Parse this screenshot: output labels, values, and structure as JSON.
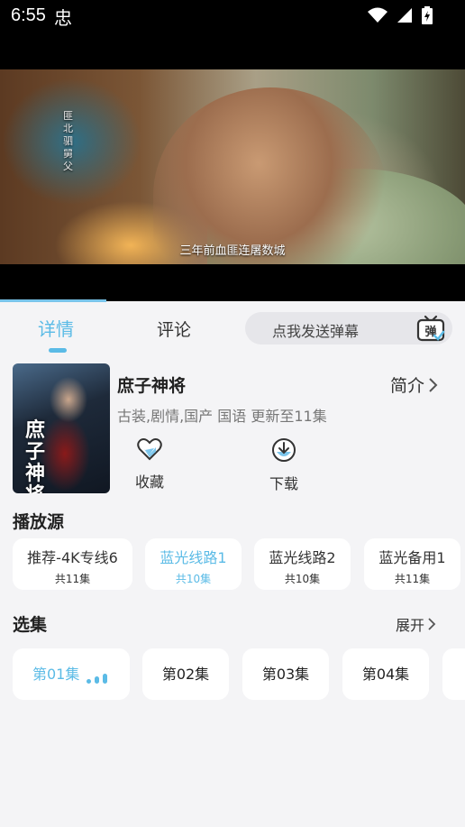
{
  "status_bar": {
    "time": "6:55",
    "notif_char": "忠"
  },
  "video": {
    "subtitle": "三年前血匪连屠数城",
    "vertical_text": "匪北驷舅父"
  },
  "tabs": {
    "detail": "详情",
    "comment": "评论"
  },
  "danmu": {
    "placeholder": "点我发送弹幕",
    "icon_char": "弹"
  },
  "show": {
    "title": "庶子神将",
    "intro_label": "简介",
    "meta": "古装,剧情,国产 国语 更新至11集",
    "poster_text": "庶子神将",
    "actions": {
      "favorite": "收藏",
      "download": "下载"
    }
  },
  "sources": {
    "title": "播放源",
    "items": [
      {
        "name": "推荐-4K专线6",
        "count": "共11集"
      },
      {
        "name": "蓝光线路1",
        "count": "共10集"
      },
      {
        "name": "蓝光线路2",
        "count": "共10集"
      },
      {
        "name": "蓝光备用1",
        "count": "共11集"
      }
    ]
  },
  "episodes": {
    "title": "选集",
    "expand_label": "展开",
    "items": [
      "第01集",
      "第02集",
      "第03集",
      "第04集"
    ]
  },
  "colors": {
    "accent": "#5bbbe6",
    "background": "#f4f4f6"
  }
}
